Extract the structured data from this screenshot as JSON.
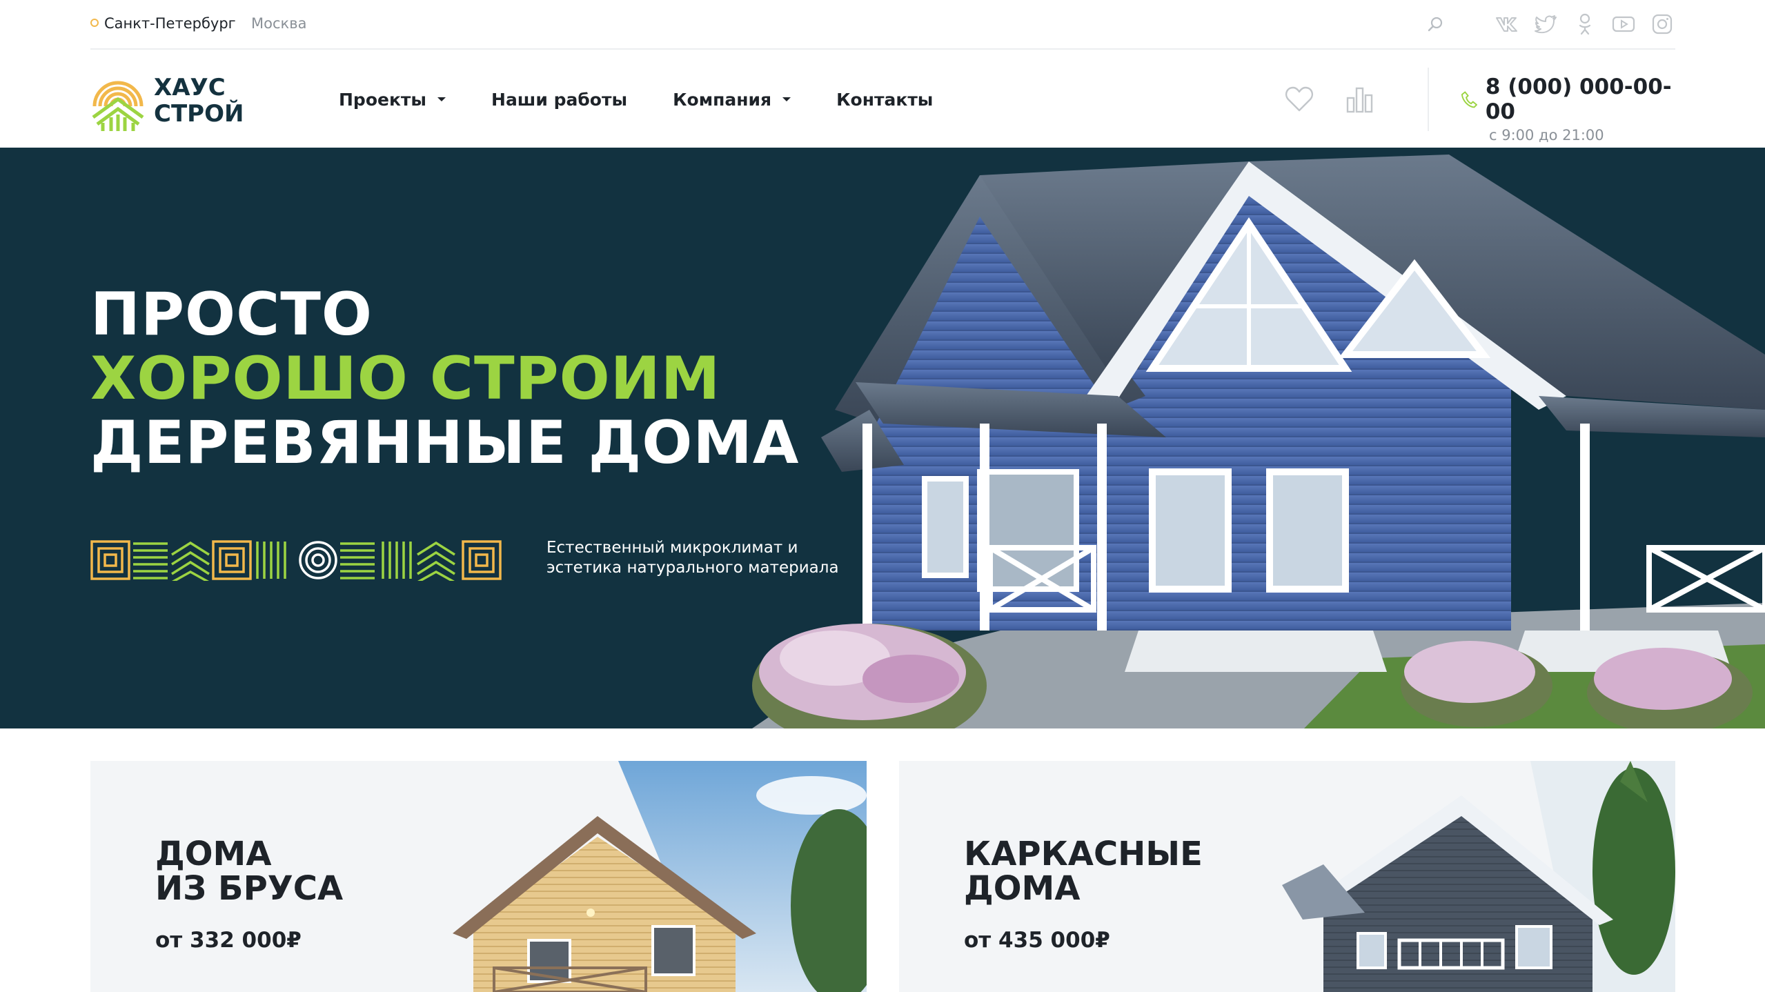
{
  "topbar": {
    "city_active": "Санкт-Петербург",
    "city_other": "Москва",
    "socials": [
      "vk-icon",
      "twitter-icon",
      "odnoklassniki-icon",
      "youtube-icon",
      "instagram-icon"
    ]
  },
  "header": {
    "logo_line1": "ХАУС",
    "logo_line2": "СТРОЙ",
    "nav": [
      {
        "label": "Проекты",
        "dropdown": true
      },
      {
        "label": "Наши работы",
        "dropdown": false
      },
      {
        "label": "Компания",
        "dropdown": true
      },
      {
        "label": "Контакты",
        "dropdown": false
      }
    ],
    "phone": "8 (000) 000-00-00",
    "hours": "с 9:00 до 21:00"
  },
  "hero": {
    "line1": "ПРОСТО",
    "line2": "ХОРОШО СТРОИМ",
    "line3": "ДЕРЕВЯННЫЕ ДОМА",
    "subtitle_line1": "Естественный микроклимат и",
    "subtitle_line2": "эстетика натурального материала"
  },
  "cards": [
    {
      "title_line1": "ДОМА",
      "title_line2": "ИЗ БРУСА",
      "price": "от 332 000₽"
    },
    {
      "title_line1": "КАРКАСНЫЕ",
      "title_line2": "ДОМА",
      "price": "от 435 000₽"
    }
  ],
  "colors": {
    "accent_green": "#9cd442",
    "hero_bg": "#123240",
    "logo_yellow": "#f2b84b",
    "card_bg": "#f3f5f7"
  }
}
